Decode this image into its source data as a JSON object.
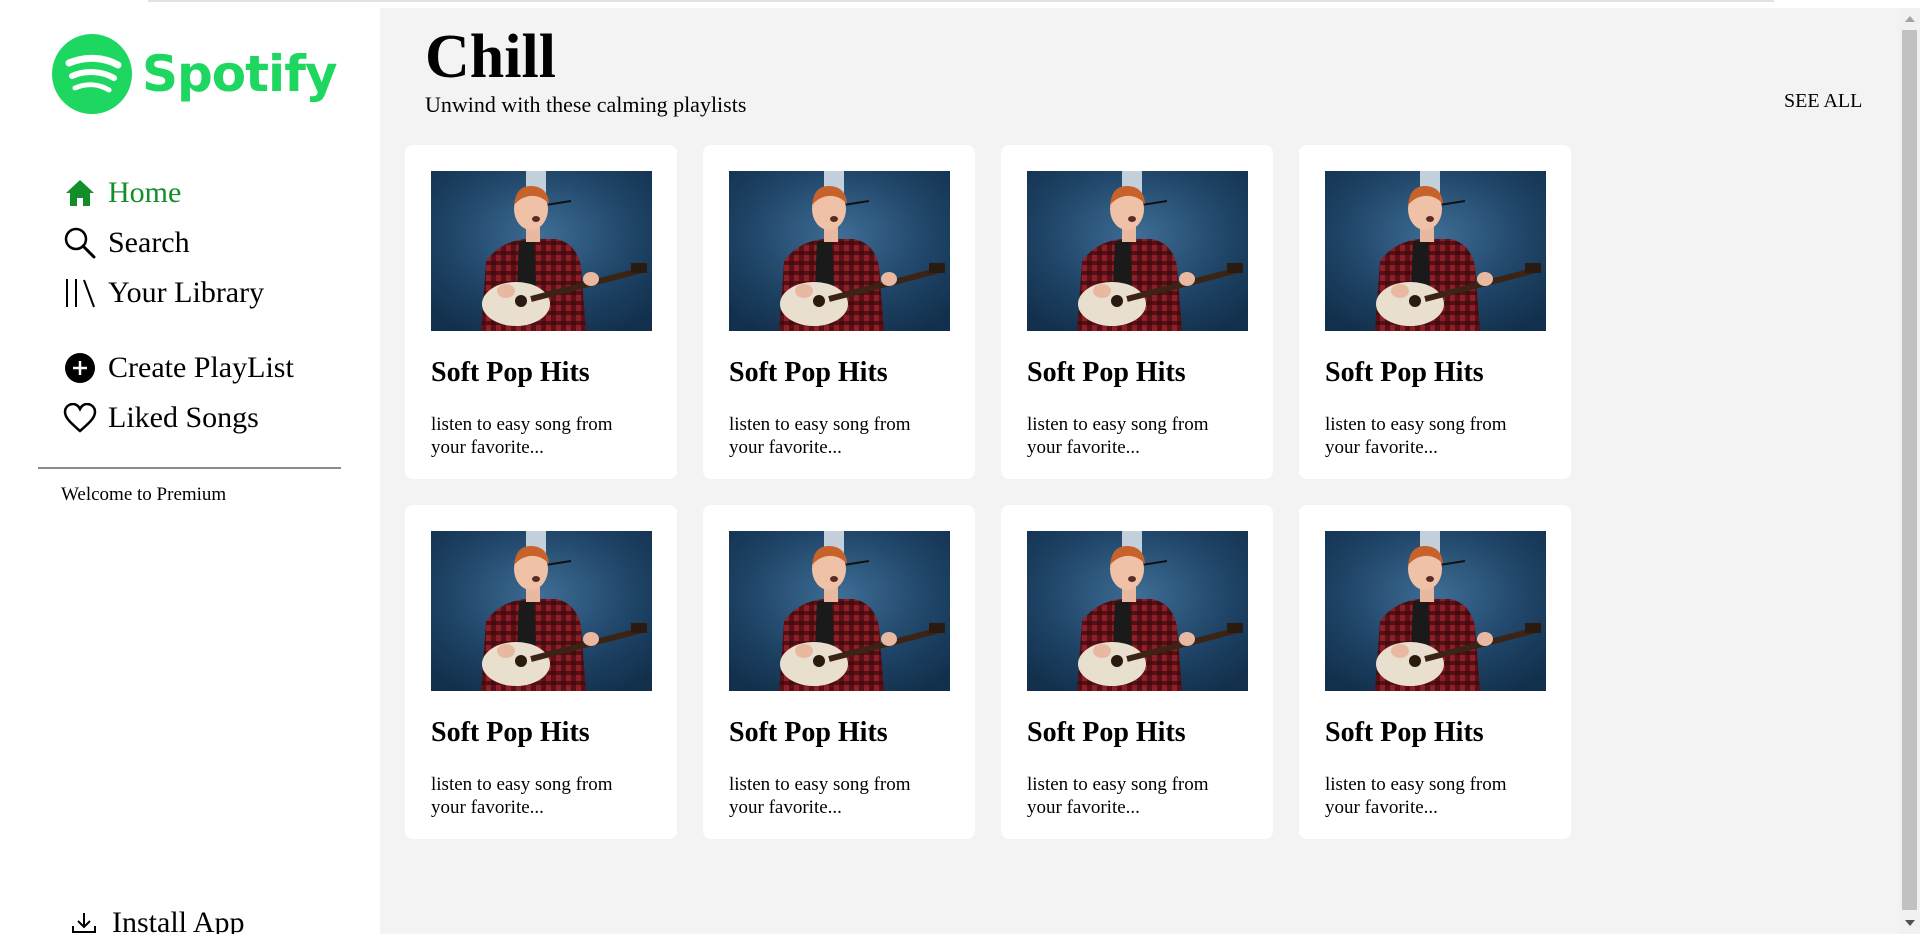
{
  "sidebar": {
    "logo_text": "Spotify",
    "nav": [
      {
        "label": "Home",
        "icon": "home-icon",
        "active": true
      },
      {
        "label": "Search",
        "icon": "search-icon"
      },
      {
        "label": "Your Library",
        "icon": "library-icon"
      }
    ],
    "actions": [
      {
        "label": "Create PlayList",
        "icon": "plus-circle-icon"
      },
      {
        "label": "Liked Songs",
        "icon": "heart-icon"
      }
    ],
    "welcome": "Welcome to Premium",
    "install": "Install App"
  },
  "main": {
    "title": "Chill",
    "subtitle": "Unwind with these calming playlists",
    "see_all": "SEE ALL",
    "cards": [
      {
        "title": "Soft Pop Hits",
        "desc": "listen to easy song from your favorite..."
      },
      {
        "title": "Soft Pop Hits",
        "desc": "listen to easy song from your favorite..."
      },
      {
        "title": "Soft Pop Hits",
        "desc": "listen to easy song from your favorite..."
      },
      {
        "title": "Soft Pop Hits",
        "desc": "listen to easy song from your favorite..."
      },
      {
        "title": "Soft Pop Hits",
        "desc": "listen to easy song from your favorite..."
      },
      {
        "title": "Soft Pop Hits",
        "desc": "listen to easy song from your favorite..."
      },
      {
        "title": "Soft Pop Hits",
        "desc": "listen to easy song from your favorite..."
      },
      {
        "title": "Soft Pop Hits",
        "desc": "listen to easy song from your favorite..."
      }
    ]
  },
  "colors": {
    "brand": "#1ed760",
    "active_nav": "#128f2a",
    "background": "#f3f3f3",
    "card": "#ffffff"
  }
}
